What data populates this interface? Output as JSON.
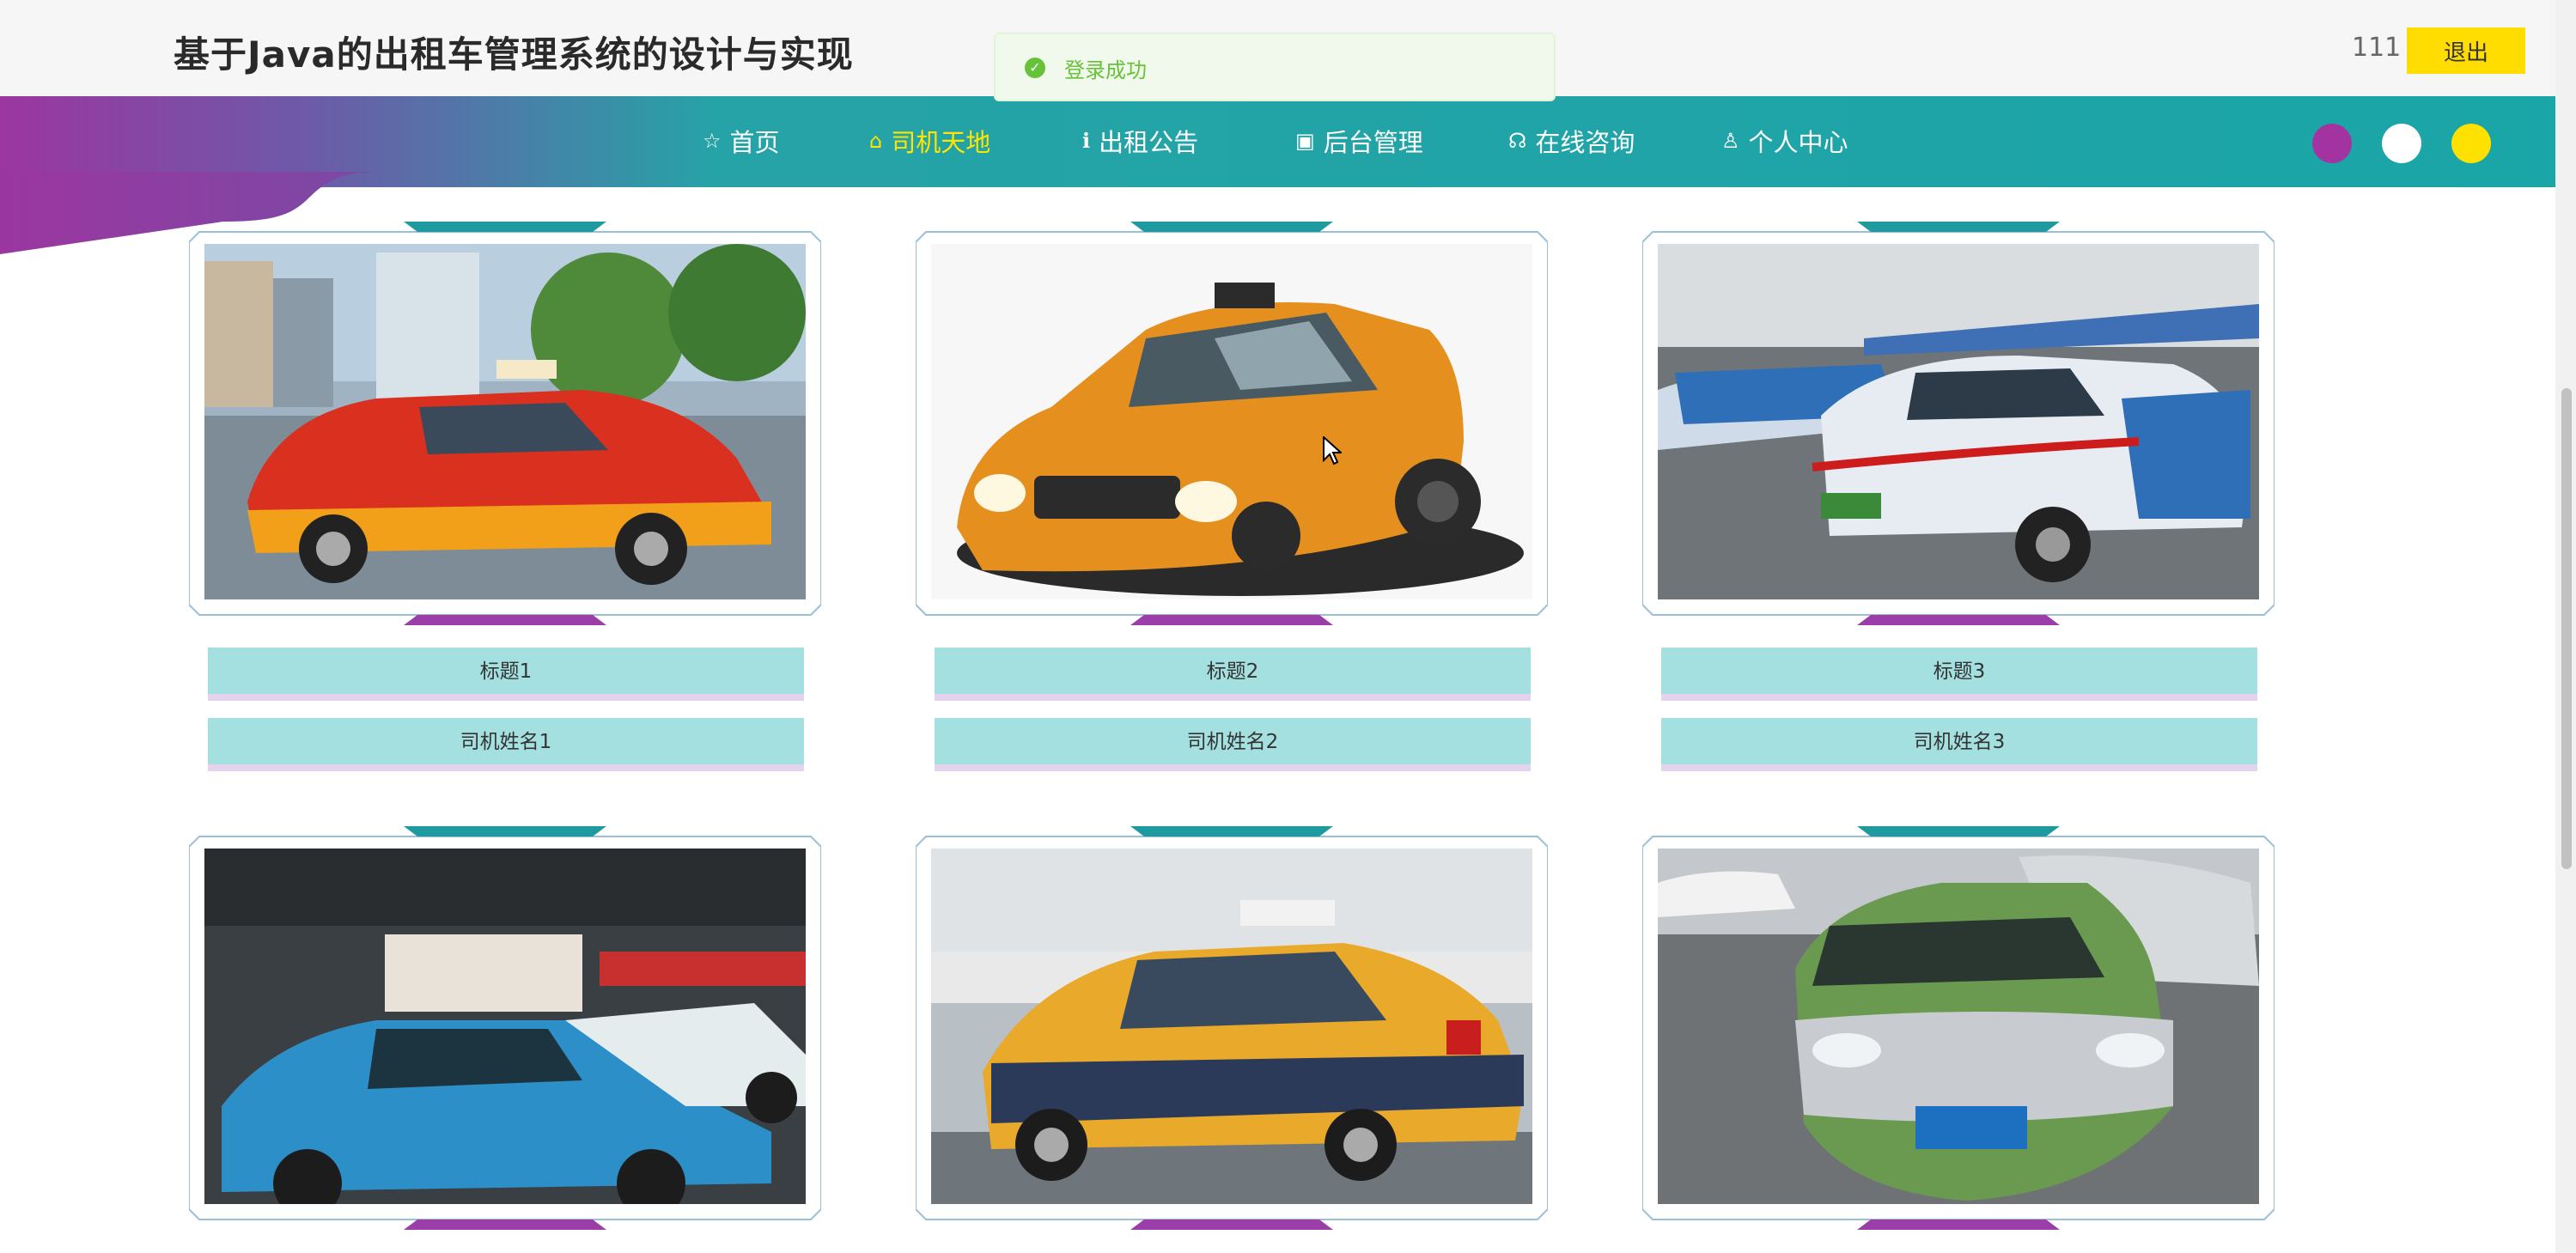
{
  "header": {
    "title": "基于Java的出租车管理系统的设计与实现",
    "user_name": "111",
    "logout_label": "退出"
  },
  "toast": {
    "message": "登录成功",
    "icon": "check-circle-icon",
    "color": "#67c23a"
  },
  "nav": {
    "items": [
      {
        "label": "首页",
        "icon": "star-icon"
      },
      {
        "label": "司机天地",
        "icon": "home-icon"
      },
      {
        "label": "出租公告",
        "icon": "info-icon"
      },
      {
        "label": "后台管理",
        "icon": "briefcase-icon"
      },
      {
        "label": "在线咨询",
        "icon": "headset-icon"
      },
      {
        "label": "个人中心",
        "icon": "user-icon"
      }
    ],
    "active_label": "司机天地",
    "active_color": "#ffe500",
    "theme_colors": [
      "#a333a0",
      "#ffffff",
      "#ffe100"
    ]
  },
  "cards": [
    {
      "title": "标题1",
      "driver": "司机姓名1"
    },
    {
      "title": "标题2",
      "driver": "司机姓名2"
    },
    {
      "title": "标题3",
      "driver": "司机姓名3"
    },
    {
      "title": "",
      "driver": ""
    },
    {
      "title": "",
      "driver": ""
    },
    {
      "title": "",
      "driver": ""
    }
  ],
  "colors": {
    "nav_teal": "#1aa5a7",
    "nav_purple": "#9b36a0",
    "label_bg": "#a5e0e0",
    "label_border": "#e3d3ee",
    "logout_bg": "#ffdd00"
  }
}
